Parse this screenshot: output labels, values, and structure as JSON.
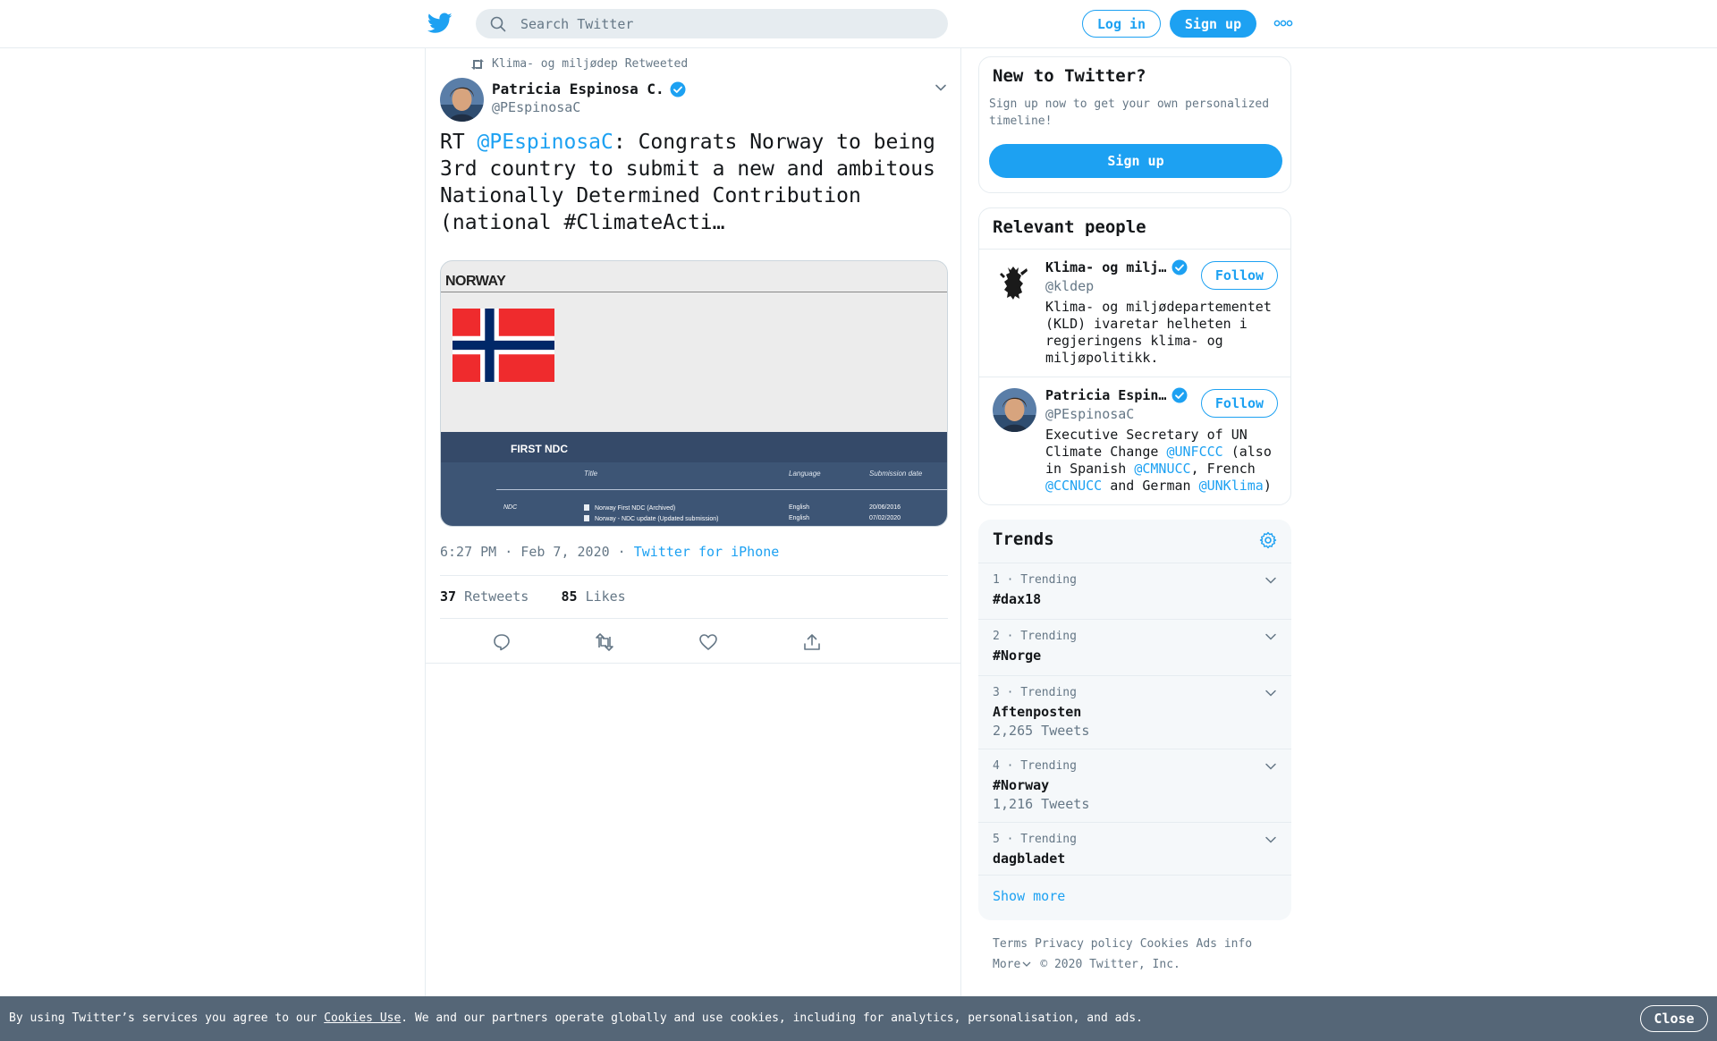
{
  "header": {
    "search_placeholder": "Search Twitter",
    "login_label": "Log in",
    "signup_label": "Sign up",
    "icons": [
      "twitter-logo-icon",
      "search-icon",
      "more-dots-icon"
    ]
  },
  "tweet": {
    "retweeted_by": "Klima- og miljødep Retweeted",
    "author_name": "Patricia Espinosa C.",
    "author_handle": "@PEspinosaC",
    "text_prefix": "RT ",
    "text_mention": "@PEspinosaC",
    "text_body": ": Congrats Norway to being 3rd country to submit a new and ambitous Nationally Determined Contribution (national #ClimateActi…",
    "media": {
      "country": "NORWAY",
      "section_title": "FIRST NDC",
      "col_title": "Title",
      "col_language": "Language",
      "col_date": "Submission date",
      "row_label": "NDC",
      "rows": [
        {
          "title": "Norway First NDC (Archived)",
          "language": "English",
          "date": "20/06/2016"
        },
        {
          "title": "Norway - NDC update (Updated submission)",
          "language": "English",
          "date": "07/02/2020"
        }
      ]
    },
    "timestamp": "6:27 PM · Feb 7, 2020",
    "separator": " · ",
    "source": "Twitter for iPhone",
    "retweets_count": "37",
    "retweets_label": "Retweets",
    "likes_count": "85",
    "likes_label": "Likes"
  },
  "sidebar": {
    "new_to_twitter": {
      "title": "New to Twitter?",
      "text": "Sign up now to get your own personalized timeline!",
      "button": "Sign up"
    },
    "relevant_people": {
      "title": "Relevant people",
      "people": [
        {
          "name": "Klima- og milj…",
          "handle": "@kldep",
          "follow": "Follow",
          "bio": "Klima- og miljødepartementet (KLD) ivaretar helheten i regjeringens klima- og miljøpolitikk."
        },
        {
          "name": "Patricia Espin…",
          "handle": "@PEspinosaC",
          "follow": "Follow",
          "bio_1": "Executive Secretary of UN Climate Change ",
          "bio_m1": "@UNFCCC",
          "bio_2": " (also in Spanish ",
          "bio_m2": "@CMNUCC",
          "bio_3": ", French ",
          "bio_m3": "@CCNUCC",
          "bio_4": " and German ",
          "bio_m4": "@UNKlima",
          "bio_5": ")"
        }
      ]
    },
    "trends": {
      "title": "Trends",
      "items": [
        {
          "meta": "1 · Trending",
          "name": "#dax18",
          "count": ""
        },
        {
          "meta": "2 · Trending",
          "name": "#Norge",
          "count": ""
        },
        {
          "meta": "3 · Trending",
          "name": "Aftenposten",
          "count": "2,265 Tweets"
        },
        {
          "meta": "4 · Trending",
          "name": "#Norway",
          "count": "1,216 Tweets"
        },
        {
          "meta": "5 · Trending",
          "name": "dagbladet",
          "count": ""
        }
      ],
      "show_more": "Show more"
    },
    "footer": {
      "terms": "Terms",
      "privacy": "Privacy policy",
      "cookies": "Cookies",
      "ads": "Ads info",
      "more": "More",
      "copyright": "© 2020 Twitter, Inc."
    }
  },
  "cookie_bar": {
    "text_before": "By using Twitter’s services you agree to our ",
    "link": "Cookies Use",
    "text_after": ". We and our partners operate globally and use cookies, including for analytics, personalisation, and ads.",
    "close": "Close"
  },
  "colors": {
    "accent": "#1da1f2",
    "text": "#14171a",
    "muted": "#657786",
    "border": "#e6ecf0",
    "cookie_bg": "#556677"
  }
}
